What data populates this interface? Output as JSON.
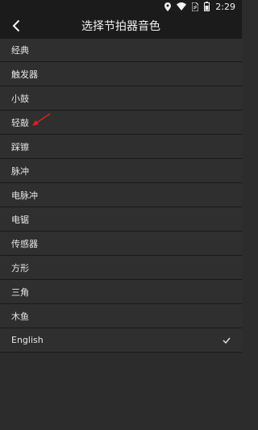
{
  "status": {
    "time": "2:29"
  },
  "header": {
    "title": "选择节拍器音色"
  },
  "sounds": [
    {
      "label": "经典",
      "selected": false
    },
    {
      "label": "触发器",
      "selected": false
    },
    {
      "label": "小鼓",
      "selected": false
    },
    {
      "label": "轻敲",
      "selected": false
    },
    {
      "label": "踩镲",
      "selected": false
    },
    {
      "label": "脉冲",
      "selected": false
    },
    {
      "label": "电脉冲",
      "selected": false
    },
    {
      "label": "电锯",
      "selected": false
    },
    {
      "label": "传感器",
      "selected": false
    },
    {
      "label": "方形",
      "selected": false
    },
    {
      "label": "三角",
      "selected": false
    },
    {
      "label": "木鱼",
      "selected": false
    },
    {
      "label": "English",
      "selected": true
    }
  ],
  "icons": {
    "back": "chevron-left-icon",
    "check": "checkmark-icon",
    "annotation": "red-arrow-icon"
  },
  "colors": {
    "annotation": "#e02020",
    "background": "#2c2c2c",
    "bar": "#1b1b1b"
  }
}
